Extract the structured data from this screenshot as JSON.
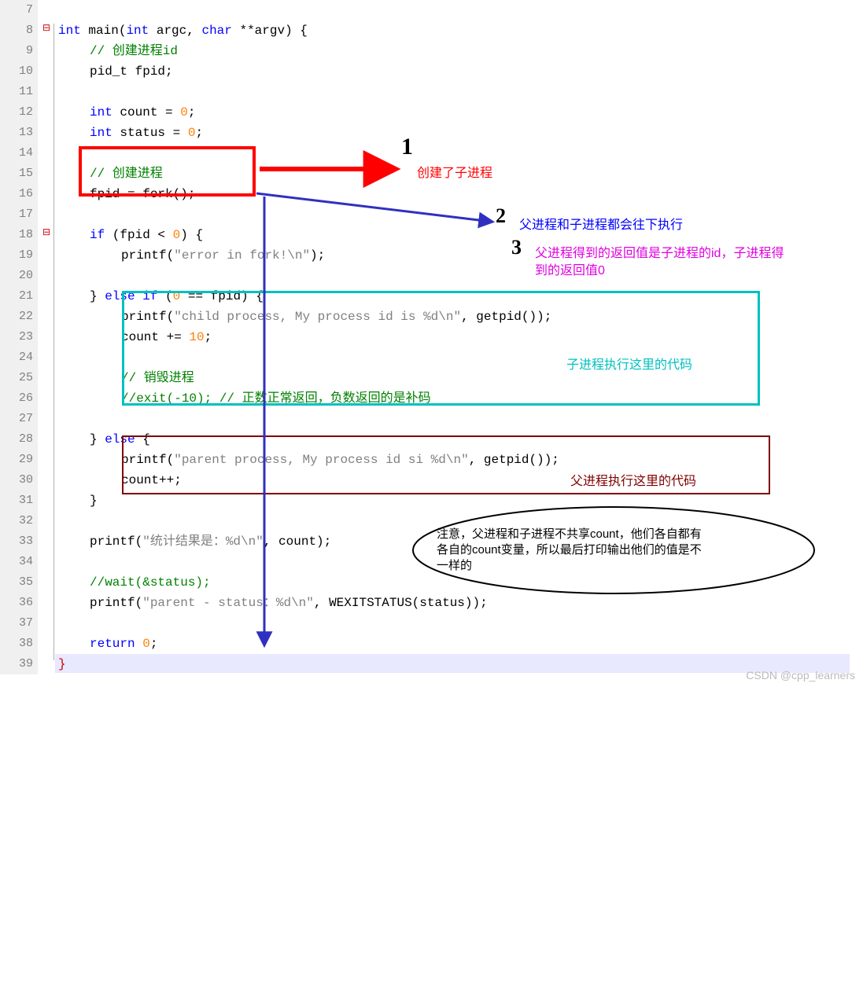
{
  "lines": {
    "7": "",
    "8": "",
    "9": "",
    "10": "",
    "11": "",
    "12": "",
    "13": "",
    "14": "",
    "15": "",
    "16": "",
    "17": "",
    "18": "",
    "19": "",
    "20": "",
    "21": "",
    "22": "",
    "23": "",
    "24": "",
    "25": "",
    "26": "",
    "27": "",
    "28": "",
    "29": "",
    "30": "",
    "31": "",
    "32": "",
    "33": "",
    "34": "",
    "35": "",
    "36": "",
    "37": "",
    "38": "",
    "39": ""
  },
  "line_numbers": [
    "7",
    "8",
    "9",
    "10",
    "11",
    "12",
    "13",
    "14",
    "15",
    "16",
    "17",
    "18",
    "19",
    "20",
    "21",
    "22",
    "23",
    "24",
    "25",
    "26",
    "27",
    "28",
    "29",
    "30",
    "31",
    "32",
    "33",
    "34",
    "35",
    "36",
    "37",
    "38",
    "39"
  ],
  "code": {
    "l8": {
      "kw1": "int",
      "fn": "main",
      "p": "(",
      "kw2": "int",
      "a1": " argc, ",
      "kw3": "char",
      "a2": " **argv) {"
    },
    "l9": {
      "cmt": "// 创建进程id"
    },
    "l10": {
      "t": "pid_t fpid;"
    },
    "l12": {
      "kw": "int",
      "rest": " count = ",
      "n": "0",
      "end": ";"
    },
    "l13": {
      "kw": "int",
      "rest": " status = ",
      "n": "0",
      "end": ";"
    },
    "l15": {
      "cmt": "// 创建进程"
    },
    "l16": {
      "t1": "fpid = fork();"
    },
    "l18": {
      "kw": "if",
      "rest": " (fpid < ",
      "n": "0",
      "end": ") {"
    },
    "l19": {
      "fn": "printf",
      "p": "(",
      "s": "\"error in fork!\\n\"",
      "end": ");"
    },
    "l21": {
      "t1": "} ",
      "kw": "else if",
      "t2": " (",
      "n1": "0",
      "t3": " == fpid) {"
    },
    "l22": {
      "fn": "printf",
      "p": "(",
      "s": "\"child process, My process id is %d\\n\"",
      "t": ", getpid());"
    },
    "l23": {
      "t1": "count += ",
      "n": "10",
      "end": ";"
    },
    "l25": {
      "cmt": "// 销毁进程"
    },
    "l26": {
      "cmt": "//exit(-10); // 正数正常返回，负数返回的是补码"
    },
    "l28": {
      "t1": "} ",
      "kw": "else",
      "t2": " {"
    },
    "l29": {
      "fn": "printf",
      "p": "(",
      "s": "\"parent process, My process id si %d\\n\"",
      "t": ", getpid());"
    },
    "l30": {
      "t": "count++;"
    },
    "l31": {
      "t": "}"
    },
    "l33": {
      "fn": "printf",
      "p": "(",
      "s": "\"统计结果是：%d\\n\"",
      "t": ", count);"
    },
    "l35": {
      "cmt": "//wait(&status);"
    },
    "l36": {
      "fn": "printf",
      "p": "(",
      "s": "\"parent - status：%d\\n\"",
      "t": ", WEXITSTATUS(status));"
    },
    "l38": {
      "kw": "return",
      "sp": " ",
      "n": "0",
      "end": ";"
    },
    "l39": {
      "t": "}"
    }
  },
  "annotations": {
    "mark1": "1",
    "red1": "创建了子进程",
    "mark2": "2",
    "blue1": "父进程和子进程都会往下执行",
    "mark3": "3",
    "magenta1": "父进程得到的返回值是子进程的id，子进程得",
    "magenta2": "到的返回值0",
    "cyan1": "子进程执行这里的代码",
    "darkred1": "父进程执行这里的代码",
    "ellipse1": "注意，父进程和子进程不共享count，他们各自都有",
    "ellipse2": "各自的count变量，所以最后打印输出他们的值是不",
    "ellipse3": "一样的"
  },
  "watermark": "CSDN @cpp_learners"
}
